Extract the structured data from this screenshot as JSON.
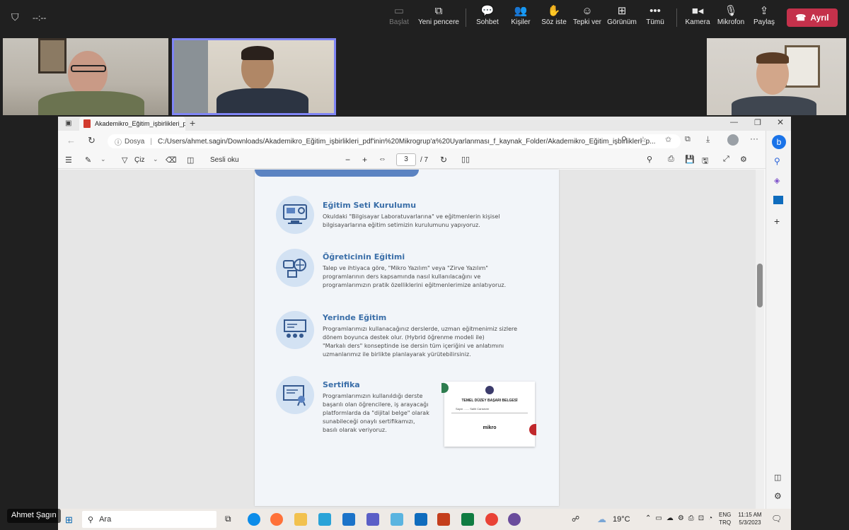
{
  "meeting": {
    "timer": "--:--",
    "buttons": [
      {
        "label": "Başlat",
        "icon": "record-icon",
        "disabled": true
      },
      {
        "label": "Yeni pencere",
        "icon": "new-window-icon"
      },
      {
        "label": "Sohbet",
        "icon": "chat-icon"
      },
      {
        "label": "Kişiler",
        "icon": "people-icon"
      },
      {
        "label": "Söz iste",
        "icon": "raise-hand-icon"
      },
      {
        "label": "Tepki ver",
        "icon": "react-icon"
      },
      {
        "label": "Görünüm",
        "icon": "view-icon"
      },
      {
        "label": "Tümü",
        "icon": "more-icon"
      },
      {
        "label": "Kamera",
        "icon": "camera-icon"
      },
      {
        "label": "Mikrofon",
        "icon": "mic-icon"
      },
      {
        "label": "Paylaş",
        "icon": "share-icon"
      }
    ],
    "leave_label": "Ayrıl",
    "presenter_name": "Ahmet Şagın"
  },
  "browser": {
    "tab_title": "Akademikro_Eğitim_işbirlikleri_p...",
    "site_label": "Dosya",
    "url": "C:/Users/ahmet.sagin/Downloads/Akademikro_Eğitim_işbirlikleri_pdf'inin%20Mikrogrup'a%20Uyarlanması_f_kaynak_Folder/Akademikro_Eğitim_işbirlikleri_p...",
    "pdf_toolbar": {
      "draw_label": "Çiz",
      "read_aloud_label": "Sesli oku",
      "page_current": "3",
      "page_total": "/ 7"
    }
  },
  "pdf": {
    "sections": [
      {
        "title": "Eğitim Seti Kurulumu",
        "lines": [
          "Okuldaki \"Bilgisayar Laboratuvarlarına\" ve eğitmenlerin kişisel",
          "bilgisayarlarına eğitim setimizin kurulumunu yapıyoruz."
        ]
      },
      {
        "title": "Öğreticinin Eğitimi",
        "lines": [
          "Talep ve ihtiyaca göre, \"Mikro Yazılım\" veya \"Zirve Yazılım\"",
          "programlarının ders kapsamında nasıl kullanılacağını ve",
          "programlarımızın pratik özelliklerini eğitmenlerimize anlatıyoruz."
        ]
      },
      {
        "title": "Yerinde Eğitim",
        "lines": [
          "Programlarımızı kullanacağınız derslerde, uzman eğitmenimiz sizlere",
          "dönem boyunca destek olur. (Hybrid öğrenme modeli ile)",
          "\"Markalı ders\" konseptinde ise dersin tüm içeriğini ve anlatımını",
          "uzmanlarımız ile birlikte planlayarak yürütebilirsiniz."
        ]
      },
      {
        "title": "Sertifika",
        "lines": [
          "Programlarımızın kullanıldığı derste",
          "başarılı olan öğrencilere, iş arayacağı",
          "platformlarda da \"dijital belge\" olarak",
          "sunabileceği onaylı sertifikamızı,",
          "basılı olarak veriyoruz."
        ]
      }
    ],
    "certificate": {
      "title": "TEMEL DÜZEY BAŞARI BELGESİ",
      "name_line": "Sayın ....... Salih Cansever",
      "logo": "mikro"
    }
  },
  "taskbar": {
    "search_placeholder": "Ara",
    "weather": "19°C",
    "lang_top": "ENG",
    "lang_bottom": "TRQ",
    "time": "11:15 AM",
    "date": "5/3/2023"
  }
}
